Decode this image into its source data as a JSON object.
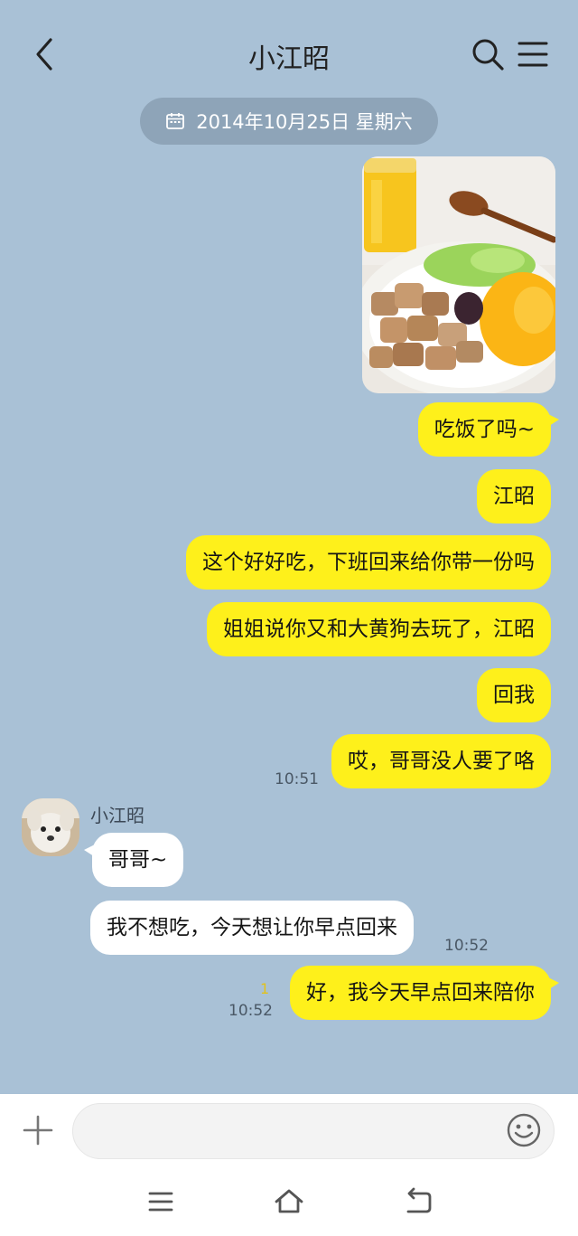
{
  "header": {
    "title": "小江昭",
    "back_icon": "chevron-left-icon",
    "search_icon": "search-icon",
    "menu_icon": "hamburger-menu-icon"
  },
  "date_divider": {
    "text": "2014年10月25日 星期六",
    "icon": "calendar-icon"
  },
  "photo_message": {
    "description_icon": "food-photo"
  },
  "messages_me_1": [
    {
      "text": "吃饭了吗~"
    },
    {
      "text": "江昭"
    },
    {
      "text": "这个好好吃，下班回来给你带一份吗"
    },
    {
      "text": "姐姐说你又和大黄狗去玩了，江昭"
    },
    {
      "text": "回我"
    },
    {
      "text": "哎，哥哥没人要了咯",
      "time": "10:51"
    }
  ],
  "other": {
    "sender_name": "小江昭",
    "messages": [
      {
        "text": "哥哥~"
      },
      {
        "text": "我不想吃，今天想让你早点回来",
        "time": "10:52"
      }
    ]
  },
  "messages_me_2": [
    {
      "text": "好，我今天早点回来陪你",
      "time": "10:52",
      "unread": "1"
    }
  ],
  "input": {
    "placeholder": "",
    "plus_icon": "plus-icon",
    "emoji_icon": "emoji-icon"
  },
  "nav": {
    "menu_icon": "recents-icon",
    "home_icon": "home-icon",
    "back_icon": "back-arrow-icon"
  },
  "colors": {
    "chat_background": "#a9c1d6",
    "my_bubble": "#fef01b",
    "other_bubble": "#ffffff",
    "date_pill": "#8ea4b8"
  }
}
